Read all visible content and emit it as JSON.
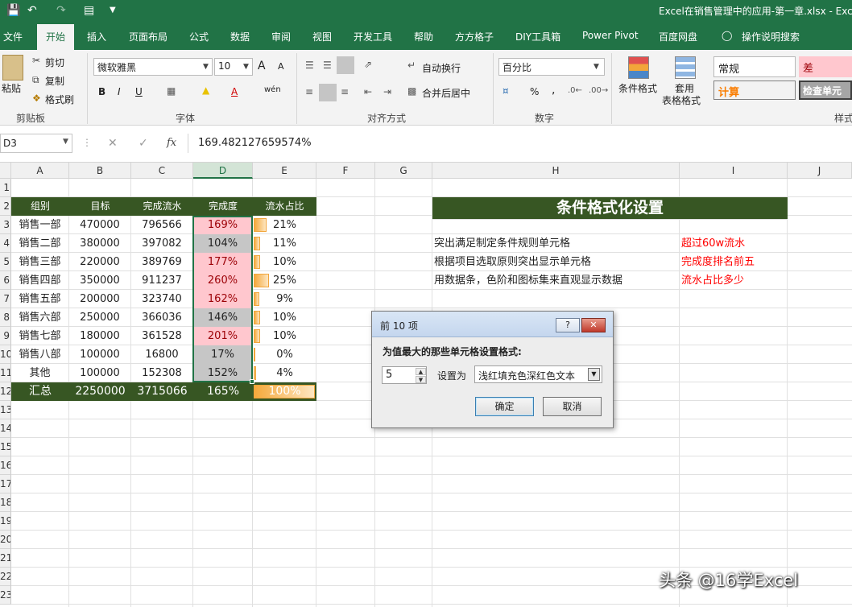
{
  "titlebar": {
    "title": "Excel在销售管理中的应用-第一章.xlsx  -  Exc",
    "save_icon": "save-icon",
    "undo_icon": "undo-icon",
    "redo_icon": "redo-icon"
  },
  "menu": [
    "文件",
    "开始",
    "插入",
    "页面布局",
    "公式",
    "数据",
    "审阅",
    "视图",
    "开发工具",
    "帮助",
    "方方格子",
    "DIY工具箱",
    "Power Pivot",
    "百度网盘",
    "操作说明搜索"
  ],
  "ribbon": {
    "paste": "粘贴",
    "cut": "剪切",
    "copy": "复制",
    "format_painter": "格式刷",
    "clipboard_group": "剪贴板",
    "font_name": "微软雅黑",
    "font_size": "10",
    "font_group": "字体",
    "bold": "B",
    "italic": "I",
    "underline": "U",
    "grow_font": "A",
    "shrink_font": "A",
    "phonetic": "wén",
    "wrap_text": "自动换行",
    "merge_center": "合并后居中",
    "align_group": "对齐方式",
    "number_format": "百分比",
    "percent": "%",
    "comma": ",",
    "number_group": "数字",
    "cond_format": "条件格式",
    "table_format_1": "套用",
    "table_format_2": "表格格式",
    "style_normal": "常规",
    "style_bad": "差",
    "style_calc": "计算",
    "style_check": "检查单元",
    "styles_group": "样式"
  },
  "formula_bar": {
    "name_box": "D3",
    "cancel": "✕",
    "enter": "✓",
    "fx": "fx",
    "value": "169.482127659574%"
  },
  "columns": [
    "A",
    "B",
    "C",
    "D",
    "E",
    "F",
    "G",
    "H",
    "I",
    "J"
  ],
  "rows": [
    "1",
    "2",
    "3",
    "4",
    "5",
    "6",
    "7",
    "8",
    "9",
    "10",
    "11",
    "12",
    "13",
    "14",
    "15",
    "16",
    "17",
    "18",
    "19",
    "20",
    "21",
    "22",
    "23"
  ],
  "table": {
    "headers": [
      "组别",
      "目标",
      "完成流水",
      "完成度",
      "流水占比"
    ],
    "rows": [
      {
        "group": "销售一部",
        "target": "470000",
        "flow": "796566",
        "rate": "169%",
        "share": "21%",
        "share_value": 21,
        "highlight": true
      },
      {
        "group": "销售二部",
        "target": "380000",
        "flow": "397082",
        "rate": "104%",
        "share": "11%",
        "share_value": 11,
        "highlight": false
      },
      {
        "group": "销售三部",
        "target": "220000",
        "flow": "389769",
        "rate": "177%",
        "share": "10%",
        "share_value": 10,
        "highlight": true
      },
      {
        "group": "销售四部",
        "target": "350000",
        "flow": "911237",
        "rate": "260%",
        "share": "25%",
        "share_value": 25,
        "highlight": true
      },
      {
        "group": "销售五部",
        "target": "200000",
        "flow": "323740",
        "rate": "162%",
        "share": "9%",
        "share_value": 9,
        "highlight": true
      },
      {
        "group": "销售六部",
        "target": "250000",
        "flow": "366036",
        "rate": "146%",
        "share": "10%",
        "share_value": 10,
        "highlight": false
      },
      {
        "group": "销售七部",
        "target": "180000",
        "flow": "361528",
        "rate": "201%",
        "share": "10%",
        "share_value": 10,
        "highlight": true
      },
      {
        "group": "销售八部",
        "target": "100000",
        "flow": "16800",
        "rate": "17%",
        "share": "0%",
        "share_value": 0,
        "highlight": false
      },
      {
        "group": "其他",
        "target": "100000",
        "flow": "152308",
        "rate": "152%",
        "share": "4%",
        "share_value": 4,
        "highlight": false
      }
    ],
    "total": {
      "group": "汇总",
      "target": "2250000",
      "flow": "3715066",
      "rate": "165%",
      "share": "100%",
      "share_value": 100
    }
  },
  "info_panel": {
    "title": "条件格式化设置",
    "items": [
      {
        "left": "突出满足制定条件规则单元格",
        "right": "超过60w流水"
      },
      {
        "left": "根据项目选取原则突出显示单元格",
        "right": "完成度排名前五"
      },
      {
        "left": "用数据条，色阶和图标集来直观显示数据",
        "right": "流水占比多少"
      }
    ]
  },
  "dialog": {
    "title": "前 10 项",
    "help": "?",
    "close": "✕",
    "prompt": "为值最大的那些单元格设置格式:",
    "count": "5",
    "set_as": "设置为",
    "format_option": "浅红填充色深红色文本",
    "ok": "确定",
    "cancel": "取消"
  },
  "watermark": "头条 @16学Excel",
  "colors": {
    "excel_green": "#217346",
    "header_green": "#375623",
    "light_red": "#ffc7ce",
    "dark_red_text": "#9c0006",
    "red_text": "#ff0000",
    "bar_orange": "#f5a93c"
  }
}
